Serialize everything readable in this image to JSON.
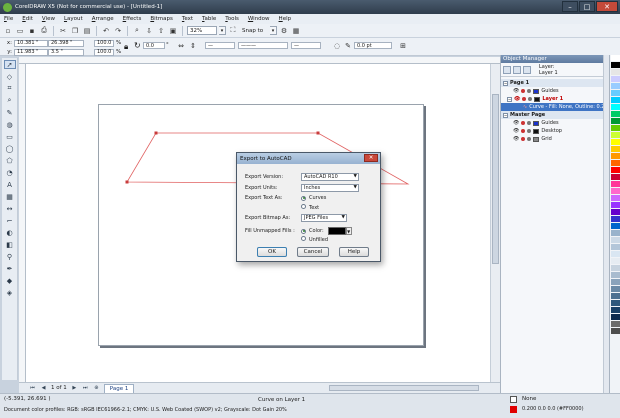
{
  "window": {
    "title": "CorelDRAW X5 (Not for commercial use) - [Untitled-1]",
    "controls": [
      "–",
      "□",
      "✕"
    ]
  },
  "menu": [
    "File",
    "Edit",
    "View",
    "Layout",
    "Arrange",
    "Effects",
    "Bitmaps",
    "Text",
    "Table",
    "Tools",
    "Window",
    "Help"
  ],
  "toolbar": {
    "zoom": "32%",
    "snap_to": "Snap to",
    "outline_width": "0.0 pt"
  },
  "propbar": {
    "x_label": "x:",
    "x_value": "10.381 \"",
    "y_label": "y:",
    "y_value": "11.983 \"",
    "w_value": "26.398 \"",
    "h_value": "3.5 \"",
    "scale_x": "100.0",
    "scale_y": "100.0",
    "pct": "%",
    "angle": "0.0",
    "degree": "°"
  },
  "object_manager": {
    "title": "Object Manager",
    "layer_label": "Layer:",
    "layer_name": "Layer 1",
    "rows": [
      {
        "kind": "header",
        "text": "Page 1"
      },
      {
        "kind": "item",
        "text": "Guides",
        "color": "#1a33cc"
      },
      {
        "kind": "item",
        "text": "Layer 1",
        "color": "#111111",
        "highlight": true
      },
      {
        "kind": "selected",
        "text": "Curve - Fill: None, Outline: 0.2"
      },
      {
        "kind": "header",
        "text": "Master Page"
      },
      {
        "kind": "item",
        "text": "Guides",
        "color": "#1a33cc"
      },
      {
        "kind": "item",
        "text": "Desktop",
        "color": "#111111"
      },
      {
        "kind": "item",
        "text": "Grid",
        "color": "#888888"
      }
    ]
  },
  "page_nav": {
    "position": "1 of 1",
    "tab": "Page 1"
  },
  "status": {
    "coords": "(-5.391, 26.691 )",
    "object_info": "Curve on Layer 1",
    "color_profiles": "Document color profiles: RGB: sRGB IEC61966-2.1; CMYK: U.S. Web Coated (SWOP) v2; Grayscale: Dot Gain 20%",
    "fill_label": "None",
    "outline_info": "0.200 0.0 0.0 (#FF0000)"
  },
  "dialog": {
    "title": "Export to AutoCAD",
    "export_version_label": "Export Version:",
    "export_version_value": "AutoCAD R10",
    "export_units_label": "Export Units:",
    "export_units_value": "Inches",
    "export_text_label": "Export Text As:",
    "text_option_curves": "Curves",
    "text_option_text": "Text",
    "export_bitmap_label": "Export Bitmap As:",
    "export_bitmap_value": "JPEG Files",
    "fill_unmapped_label": "Fill Unmapped Fills :",
    "fill_option_color": "Color:",
    "fill_option_unfilled": "Unfilled",
    "ok": "OK",
    "cancel": "Cancel",
    "help": "Help"
  },
  "palette": [
    "#ffffff",
    "#000000",
    "#e6e6e6",
    "#ccccff",
    "#99ccff",
    "#66ccff",
    "#00ccff",
    "#00ffff",
    "#00cc66",
    "#009933",
    "#66cc00",
    "#ccff33",
    "#ffff00",
    "#ffcc00",
    "#ff9900",
    "#ff6600",
    "#ff0000",
    "#cc0033",
    "#ff3399",
    "#ff66cc",
    "#cc66ff",
    "#9933ff",
    "#6600cc",
    "#3333cc",
    "#0066cc",
    "#99b3cc",
    "#ccd9e6",
    "#b3c6d9",
    "#d9e6f2",
    "#e6ecf2",
    "#c7d3df",
    "#a9bccf",
    "#8aa3bb",
    "#6b8aa6",
    "#4d7191",
    "#2f587c",
    "#1a4066",
    "#0d2a4d",
    "#6b6b6b",
    "#4d4d4d"
  ],
  "colors": {
    "curve_outline": "#e06060",
    "node": "#c83c3c"
  }
}
